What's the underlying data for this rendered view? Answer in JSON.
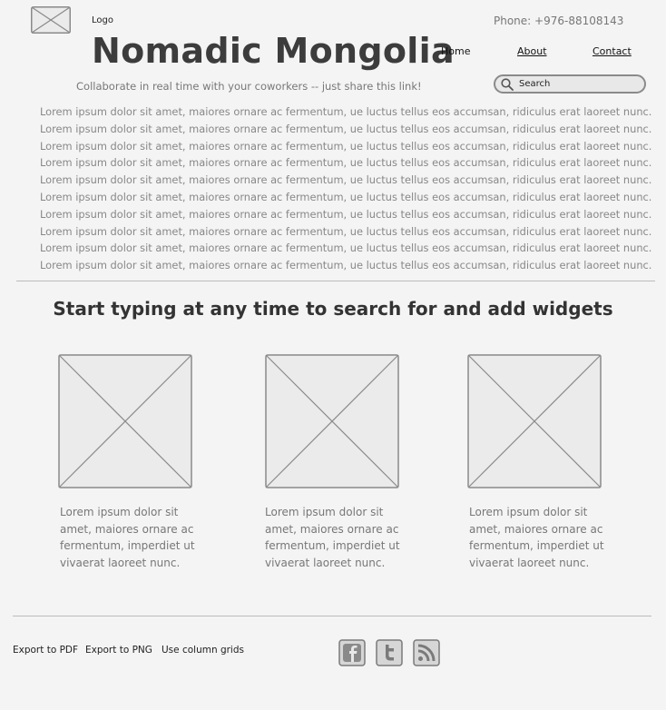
{
  "header": {
    "logo_label": "Logo",
    "site_title": "Nomadic Mongolia",
    "phone": "Phone: +976-88108143",
    "tagline": "Collaborate in real time with your coworkers -- just share this link!"
  },
  "nav": {
    "items": [
      {
        "label": "Home"
      },
      {
        "label": "About"
      },
      {
        "label": "Contact"
      }
    ]
  },
  "search": {
    "placeholder": "Search",
    "icon": "search-icon"
  },
  "intro": {
    "lines": [
      "Lorem ipsum dolor sit amet, maiores ornare ac fermentum, ue luctus tellus eos accumsan, ridiculus erat laoreet nunc.",
      "Lorem ipsum dolor sit amet, maiores ornare ac fermentum, ue luctus tellus eos accumsan, ridiculus erat laoreet nunc.",
      "Lorem ipsum dolor sit amet, maiores ornare ac fermentum, ue luctus tellus eos accumsan, ridiculus erat laoreet nunc.",
      "Lorem ipsum dolor sit amet, maiores ornare ac fermentum, ue luctus tellus eos accumsan, ridiculus erat laoreet nunc.",
      "Lorem ipsum dolor sit amet, maiores ornare ac fermentum, ue luctus tellus eos accumsan, ridiculus erat laoreet nunc.",
      "Lorem ipsum dolor sit amet, maiores ornare ac fermentum, ue luctus tellus eos accumsan, ridiculus erat laoreet nunc.",
      "Lorem ipsum dolor sit amet, maiores ornare ac fermentum, ue luctus tellus eos accumsan, ridiculus erat laoreet nunc.",
      "Lorem ipsum dolor sit amet, maiores ornare ac fermentum, ue luctus tellus eos accumsan, ridiculus erat laoreet nunc.",
      "Lorem ipsum dolor sit amet, maiores ornare ac fermentum, ue luctus tellus eos accumsan, ridiculus erat laoreet nunc.",
      "Lorem ipsum dolor sit amet, maiores ornare ac fermentum, ue luctus tellus eos accumsan, ridiculus erat laoreet nunc."
    ]
  },
  "main": {
    "heading": "Start typing at any time to search for and add widgets",
    "cards": [
      {
        "text": "Lorem ipsum dolor sit amet, maiores ornare ac fermentum, imperdiet ut vivaerat laoreet nunc."
      },
      {
        "text": "Lorem ipsum dolor sit amet, maiores ornare ac fermentum, imperdiet ut vivaerat laoreet nunc."
      },
      {
        "text": "Lorem ipsum dolor sit amet, maiores ornare ac fermentum, imperdiet ut vivaerat laoreet nunc."
      }
    ]
  },
  "footer": {
    "links": [
      {
        "label": "Export to PDF"
      },
      {
        "label": "Export to PNG"
      },
      {
        "label": "Use column grids"
      }
    ],
    "social_icons": [
      "facebook-icon",
      "twitter-icon",
      "rss-icon"
    ]
  },
  "colors": {
    "background": "#f4f4f4",
    "placeholder_fill": "#ebebeb",
    "placeholder_stroke": "#8a8a8a",
    "muted_text": "#888888"
  }
}
